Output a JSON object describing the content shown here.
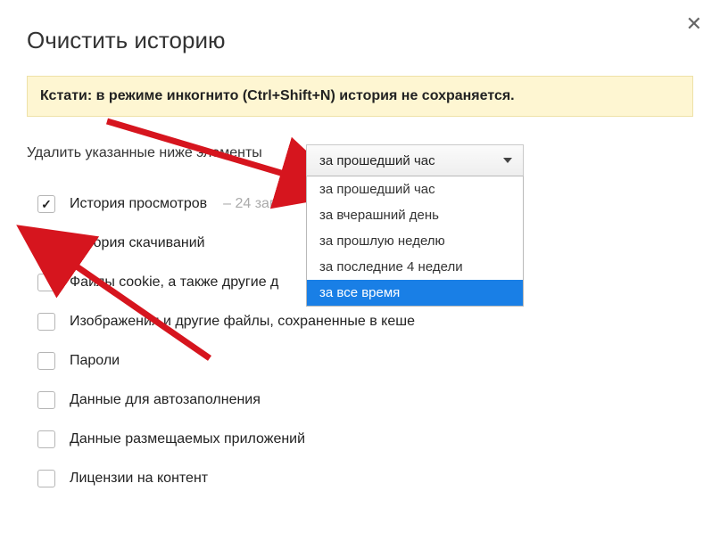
{
  "title": "Очистить историю",
  "info_bar": "Кстати: в режиме инкогнито (Ctrl+Shift+N) история не сохраняется.",
  "label_delete": "Удалить указанные ниже элементы",
  "dropdown": {
    "selected": "за прошедший час",
    "options": [
      "за прошедший час",
      "за вчерашний день",
      "за прошлую неделю",
      "за последние 4 недели",
      "за все время"
    ],
    "highlighted_index": 4
  },
  "items": [
    {
      "label": "История просмотров",
      "extra": "– 24 зап",
      "checked": true
    },
    {
      "label": "История скачиваний",
      "extra": "",
      "checked": true
    },
    {
      "label": "Файлы cookie, а также другие д",
      "extra": "",
      "checked": false
    },
    {
      "label": "Изображения и другие файлы, сохраненные в кеше",
      "extra": "",
      "checked": false
    },
    {
      "label": "Пароли",
      "extra": "",
      "checked": false
    },
    {
      "label": "Данные для автозаполнения",
      "extra": "",
      "checked": false
    },
    {
      "label": "Данные размещаемых приложений",
      "extra": "",
      "checked": false
    },
    {
      "label": "Лицензии на контент",
      "extra": "",
      "checked": false
    }
  ],
  "colors": {
    "info_bg": "#fef6d2",
    "info_border": "#eee1a7",
    "highlight": "#197fe6",
    "arrow": "#d6151e"
  }
}
